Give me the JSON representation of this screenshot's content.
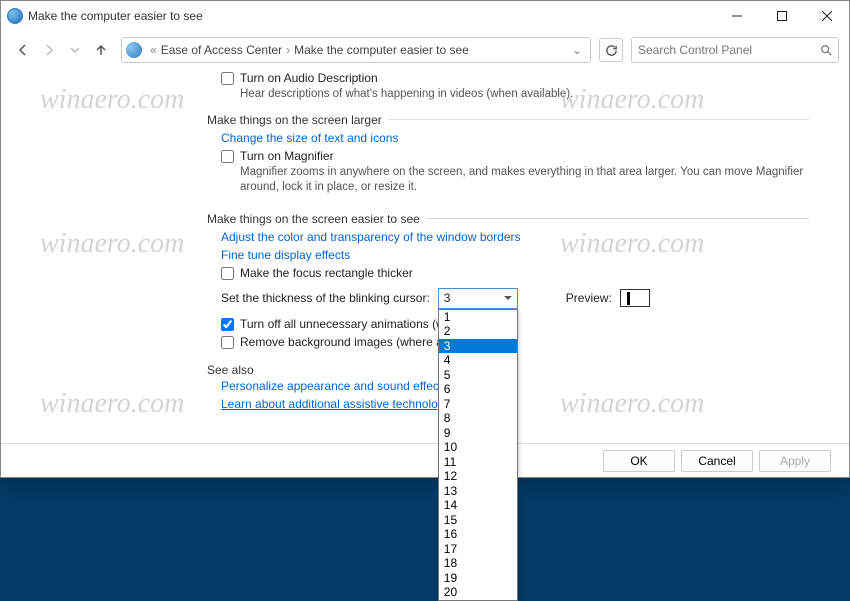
{
  "window": {
    "title": "Make the computer easier to see"
  },
  "nav": {
    "bc1": "Ease of Access Center",
    "bc2": "Make the computer easier to see"
  },
  "search": {
    "placeholder": "Search Control Panel"
  },
  "opts": {
    "audio_chk": "Turn on Audio Description",
    "audio_sub": "Hear descriptions of what's happening in videos (when available).",
    "group_larger": "Make things on the screen larger",
    "link_size": "Change the size of text and icons",
    "mag_chk": "Turn on Magnifier",
    "mag_sub": "Magnifier zooms in anywhere on the screen, and makes everything in that area larger. You can move Magnifier around, lock it in place, or resize it.",
    "group_easier": "Make things on the screen easier to see",
    "link_colors": "Adjust the color and transparency of the window borders",
    "link_tune": "Fine tune display effects",
    "focus_chk": "Make the focus rectangle thicker",
    "cursor_label": "Set the thickness of the blinking cursor:",
    "cursor_value": "3",
    "preview_label": "Preview:",
    "anim_chk": "Turn off all unnecessary animations (when possible)",
    "bg_chk": "Remove background images (where available)",
    "seealso": "See also",
    "link_personalize": "Personalize appearance and sound effects",
    "link_learn": "Learn about additional assistive technologies online"
  },
  "dropdown": {
    "selected": "3",
    "options": [
      "1",
      "2",
      "3",
      "4",
      "5",
      "6",
      "7",
      "8",
      "9",
      "10",
      "11",
      "12",
      "13",
      "14",
      "15",
      "16",
      "17",
      "18",
      "19",
      "20"
    ]
  },
  "buttons": {
    "ok": "OK",
    "cancel": "Cancel",
    "apply": "Apply"
  },
  "watermark": "winaero.com"
}
